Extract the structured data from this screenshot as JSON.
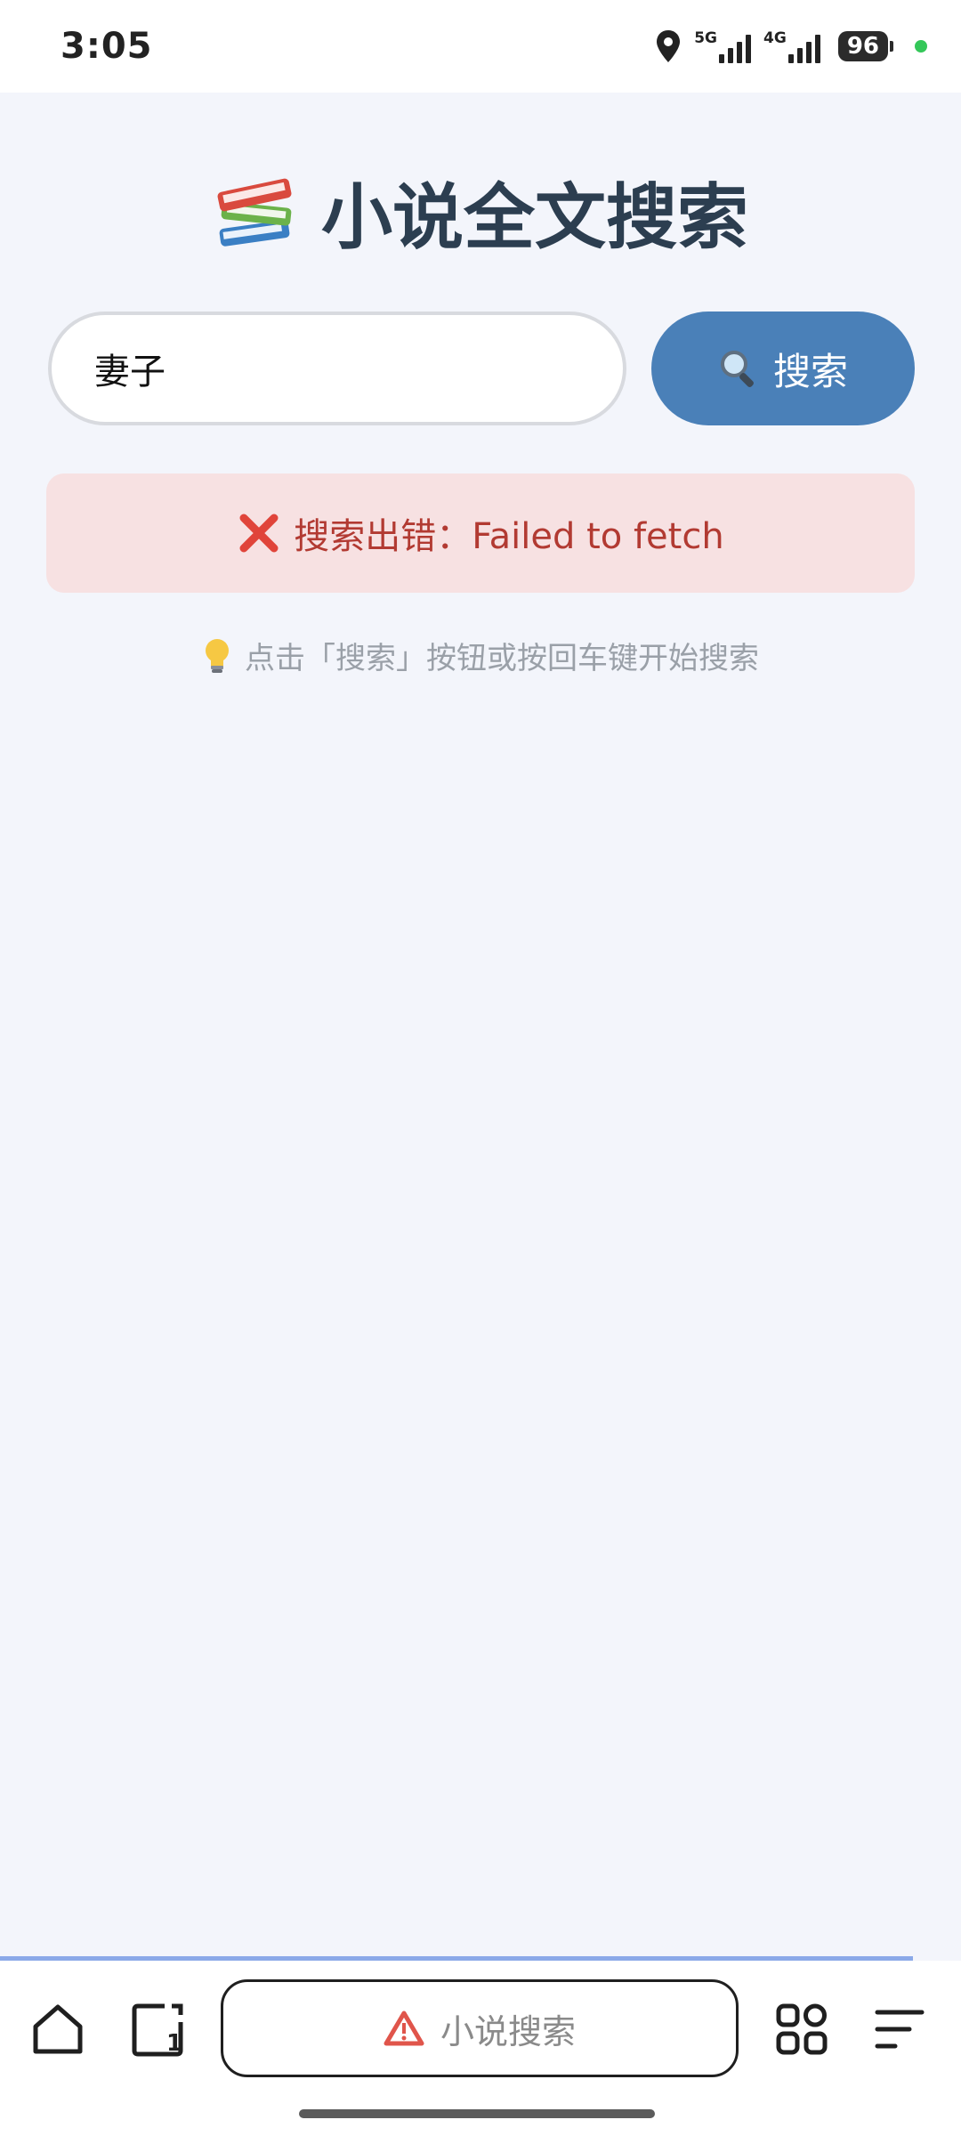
{
  "status_bar": {
    "time": "3:05",
    "network_5g": "5G",
    "network_4g": "4G",
    "battery": "96"
  },
  "page": {
    "title": "小说全文搜索",
    "title_icon": "books-icon"
  },
  "search": {
    "value": "妻子",
    "button_label": "搜索",
    "button_icon": "magnifier-icon"
  },
  "error": {
    "icon": "cross-icon",
    "message": "搜索出错：Failed to fetch"
  },
  "hint": {
    "icon": "lightbulb-icon",
    "text": "点击「搜索」按钮或按回车键开始搜索"
  },
  "browser_bar": {
    "address_label": "小说搜索",
    "address_icon": "warning-icon",
    "tab_count": "1",
    "colors": {
      "progress": "#8ba9e8",
      "warning": "#e0554b"
    }
  },
  "colors": {
    "accent": "#4a80b8",
    "error_bg": "#f7e1e2",
    "error_text": "#b23a32",
    "background": "#f3f5fb"
  }
}
